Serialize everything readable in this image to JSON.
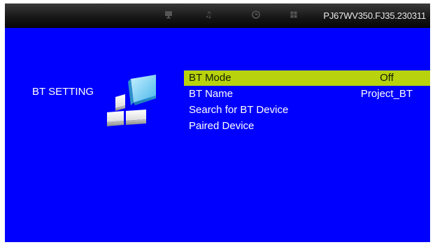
{
  "header": {
    "firmware_version": "PJ67WV350.FJ35.230311",
    "icons": [
      "monitor-icon",
      "music-note-icon",
      "clock-icon",
      "grid-icon"
    ]
  },
  "section": {
    "label": "BT SETTING",
    "illustration_icon": "bt-settings-blocks-icon"
  },
  "menu": {
    "items": [
      {
        "label": "BT Mode",
        "value": "Off",
        "selected": true
      },
      {
        "label": "BT Name",
        "value": "Project_BT",
        "selected": false
      },
      {
        "label": "Search for BT Device",
        "value": "",
        "selected": false
      },
      {
        "label": "Paired Device",
        "value": "",
        "selected": false
      }
    ]
  },
  "colors": {
    "background": "#0000ff",
    "top_bar": "#111111",
    "highlight": "#b9d20e",
    "text": "#ffffff"
  }
}
